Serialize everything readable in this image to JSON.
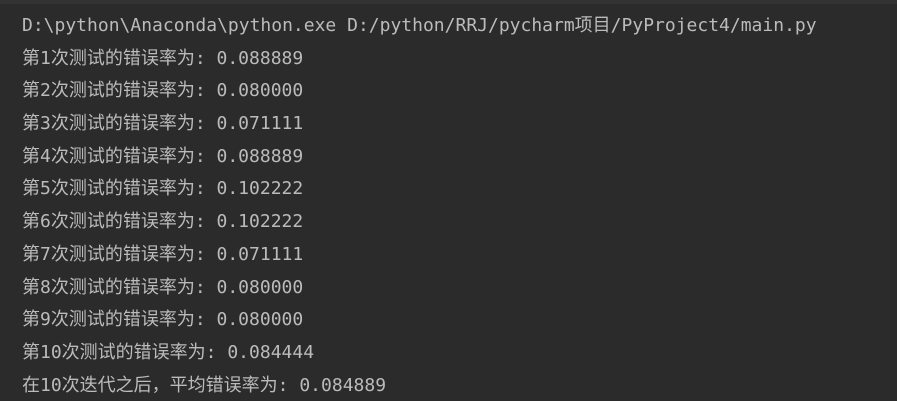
{
  "console": {
    "command_line": "D:\\python\\Anaconda\\python.exe D:/python/RRJ/pycharm项目/PyProject4/main.py",
    "lines": [
      "第1次测试的错误率为: 0.088889",
      "第2次测试的错误率为: 0.080000",
      "第3次测试的错误率为: 0.071111",
      "第4次测试的错误率为: 0.088889",
      "第5次测试的错误率为: 0.102222",
      "第6次测试的错误率为: 0.102222",
      "第7次测试的错误率为: 0.071111",
      "第8次测试的错误率为: 0.080000",
      "第9次测试的错误率为: 0.080000",
      "第10次测试的错误率为: 0.084444",
      "在10次迭代之后，平均错误率为: 0.084889"
    ]
  },
  "colors": {
    "background": "#2b2b2b",
    "text": "#bbbbbb"
  }
}
